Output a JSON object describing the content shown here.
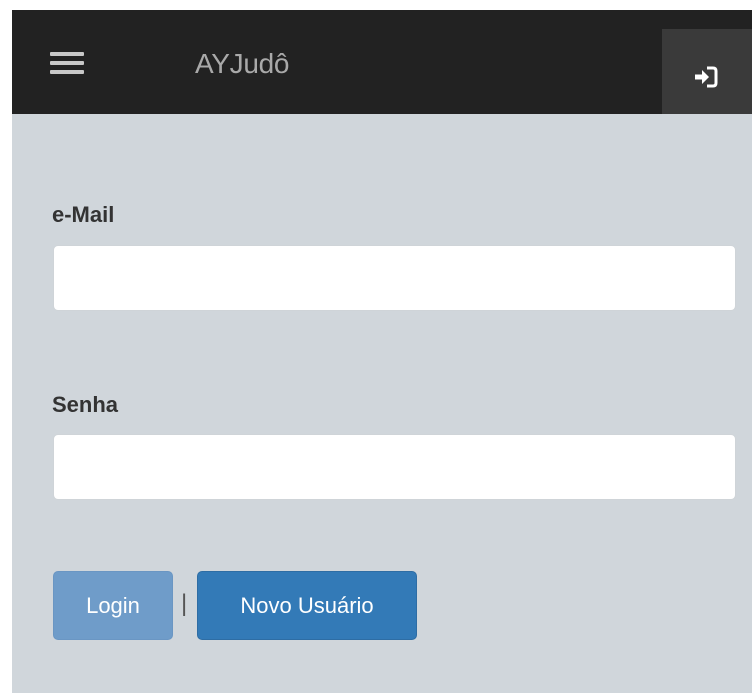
{
  "navbar": {
    "brand": "AYJudô",
    "menu_icon": "hamburger-icon",
    "login_icon": "sign-in-icon",
    "background": "#222222"
  },
  "form": {
    "email_label": "e-Mail",
    "email_value": "",
    "senha_label": "Senha",
    "senha_value": "",
    "separator": "|",
    "login_button": "Login",
    "new_user_button": "Novo Usuário"
  },
  "colors": {
    "page_background": "#d0d6db",
    "primary_button": "#337ab7",
    "login_button": "#6f9cc9"
  }
}
